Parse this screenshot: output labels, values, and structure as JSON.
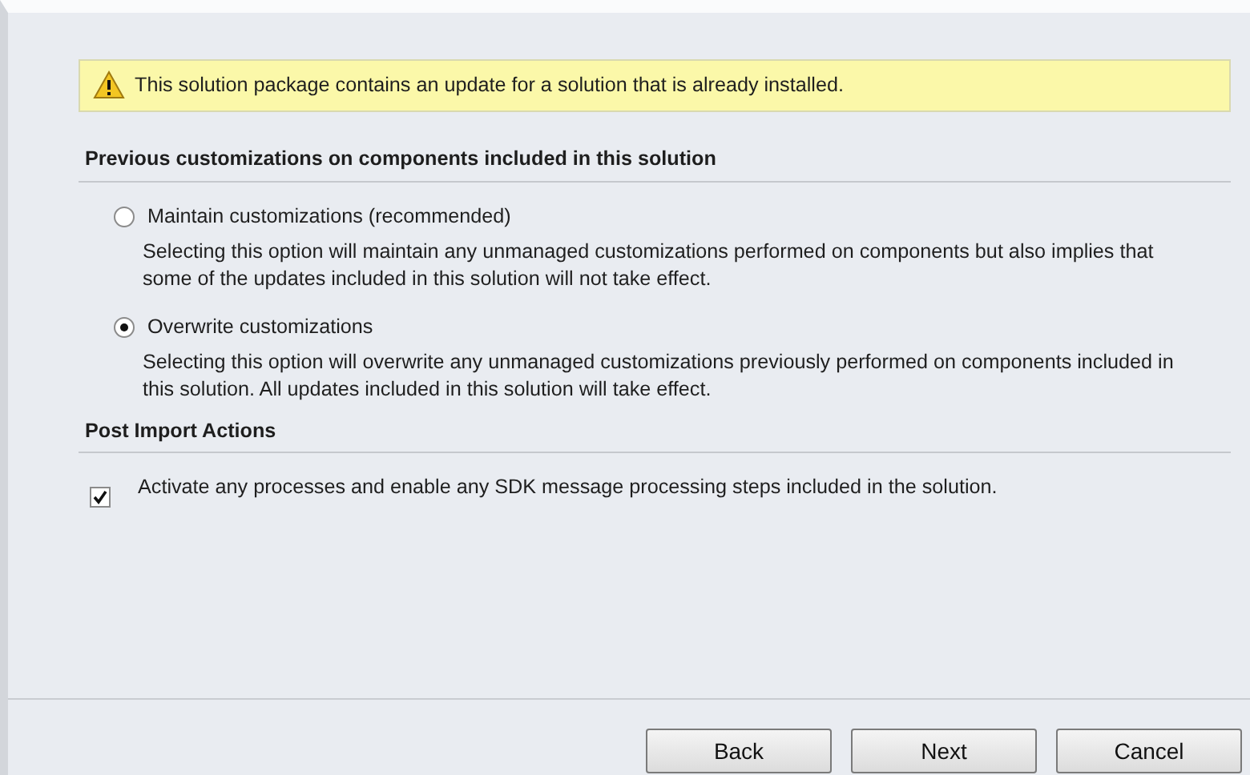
{
  "warning": {
    "text": "This solution package contains an update for a solution that is already installed."
  },
  "sections": [
    {
      "title": "Previous customizations on components included in this solution",
      "options": [
        {
          "kind": "radio",
          "label": "Maintain customizations (recommended)",
          "selected": false,
          "description": "Selecting this option will maintain any unmanaged customizations performed on components but also implies that some of the updates included in this solution will not take effect."
        },
        {
          "kind": "radio",
          "label": "Overwrite customizations",
          "selected": true,
          "description": "Selecting this option will overwrite any unmanaged customizations previously performed on components included in this solution. All updates included in this solution will take effect."
        }
      ]
    },
    {
      "title": "Post Import Actions",
      "options": [
        {
          "kind": "checkbox",
          "label": "Activate any processes and enable any SDK message processing steps included in the solution.",
          "checked": true
        }
      ]
    }
  ],
  "buttons": [
    "Back",
    "Next",
    "Cancel"
  ]
}
